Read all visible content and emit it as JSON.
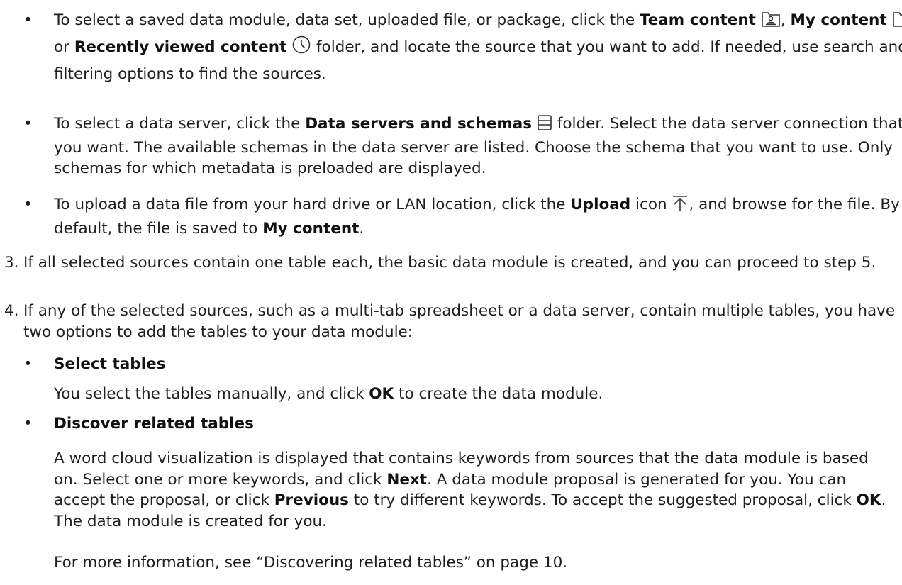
{
  "bullets_top": [
    {
      "seg1": "To select a saved data module, data set, uploaded file, or package, click the ",
      "bold1": "Team content",
      "icon1": "team-folder-icon",
      "seg2": ", ",
      "bold2": "My content",
      "icon2": "folder-icon",
      "seg3": ", or ",
      "bold3": "Recently viewed content",
      "icon3": "clock-icon",
      "seg4": " folder, and locate the source that you want to add. If needed, use search and filtering options to find the sources."
    },
    {
      "seg1": "To select a data server, click the ",
      "bold1": "Data servers and schemas",
      "icon1": "database-icon",
      "seg2": " folder. Select the data server connection that you want. The available schemas in the data server are listed. Choose the schema that you want to use. Only schemas for which metadata is preloaded are displayed."
    },
    {
      "seg1": "To upload a data file from your hard drive or LAN location, click the ",
      "bold1": "Upload",
      "seg2": " icon ",
      "icon1": "upload-icon",
      "seg3": ", and browse for the file. By default, the file is saved to ",
      "bold2": "My content",
      "seg4": "."
    }
  ],
  "steps": [
    {
      "num": "3.",
      "text": "If all selected sources contain one table each, the basic data module is created, and you can proceed to step 5."
    },
    {
      "num": "4.",
      "text": "If any of the selected sources, such as a multi-tab spreadsheet or a data server, contain multiple tables, you have two options to add the tables to your data module:"
    }
  ],
  "options": {
    "select_title": "Select tables",
    "select_seg1": "You select the tables manually, and click ",
    "select_bold": "OK",
    "select_seg2": " to create the data module.",
    "discover_title": "Discover related tables",
    "discover_seg1": "A word cloud visualization is displayed that contains keywords from sources that the data module is based on. Select one or more keywords, and click ",
    "discover_bold1": "Next",
    "discover_seg2": ". A data module proposal is generated for you. You can accept the proposal, or click ",
    "discover_bold2": "Previous",
    "discover_seg3": " to try different keywords. To accept the suggested proposal, click ",
    "discover_bold3": "OK",
    "discover_seg4": ". The data module is created for you.",
    "more_info": "For more information, see “Discovering related tables” on page 10."
  }
}
